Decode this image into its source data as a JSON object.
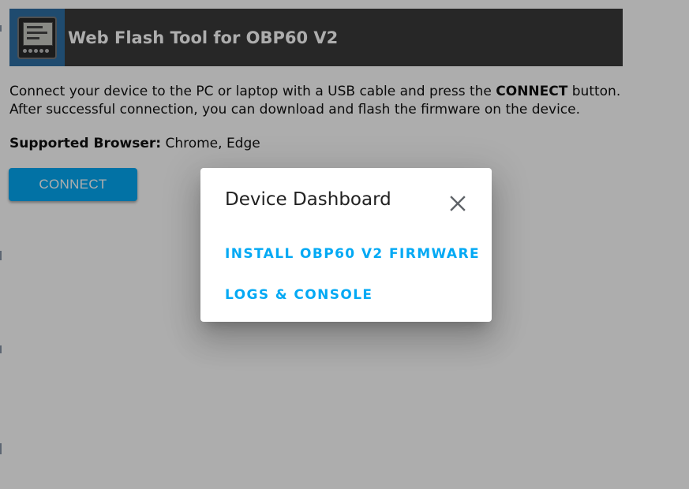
{
  "header": {
    "title": "Web Flash Tool for OBP60 V2",
    "logo_icon": "obp60-device-icon"
  },
  "intro": {
    "line1_before": "Connect your device to the PC or laptop with a USB cable and press the ",
    "line1_bold": "CONNECT",
    "line1_after": " button.",
    "line2": "After successful connection, you can download and flash the firmware on the device."
  },
  "browsers": {
    "label": "Supported Browser:",
    "value": " Chrome, Edge"
  },
  "connect_button": {
    "label": "CONNECT"
  },
  "dialog": {
    "title": "Device Dashboard",
    "close_icon": "close-icon",
    "actions": [
      {
        "label": "INSTALL OBP60 V2 FIRMWARE"
      },
      {
        "label": "LOGS & CONSOLE"
      }
    ]
  },
  "colors": {
    "accent": "#03a9f4",
    "header_bg": "#3a3a3a",
    "logo_bg": "#2f6fa4",
    "scrim": "rgba(0,0,0,0.32)"
  }
}
